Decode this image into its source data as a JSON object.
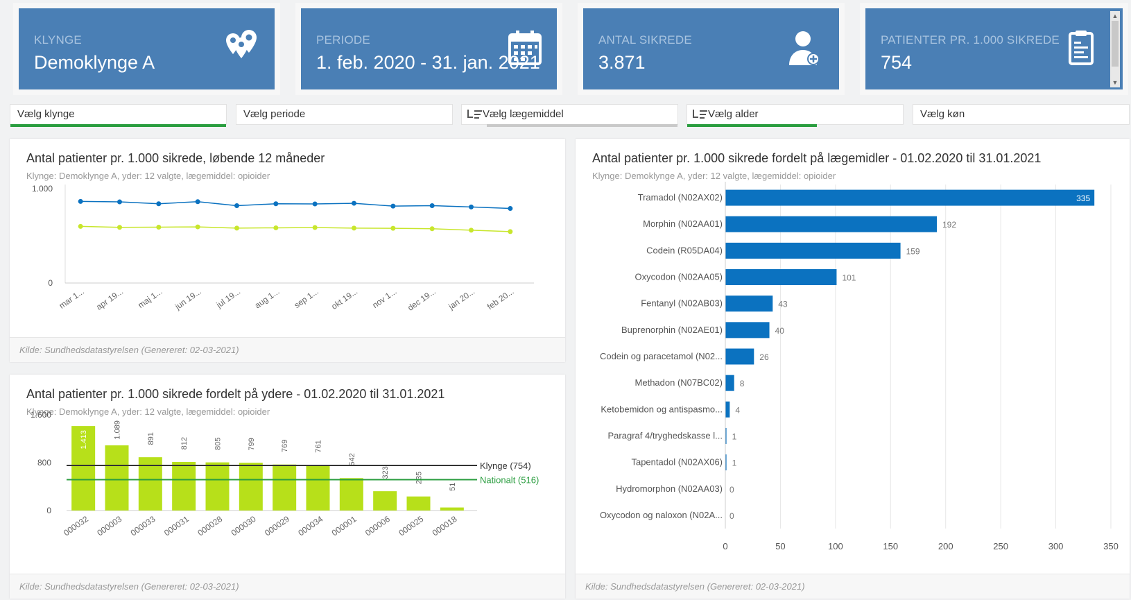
{
  "kpis": [
    {
      "label": "KLYNGE",
      "value": "Demoklynge A",
      "icon": "map-pins-icon"
    },
    {
      "label": "PERIODE",
      "value": "1. feb. 2020 - 31. jan. 2021",
      "icon": "calendar-icon"
    },
    {
      "label": "ANTAL SIKREDE",
      "value": "3.871",
      "icon": "user-plus-icon"
    },
    {
      "label": "PATIENTER PR. 1.000 SIKREDE",
      "value": "754",
      "icon": "clipboard-icon"
    }
  ],
  "filters": [
    {
      "label": "Vælg klynge",
      "has_icon": false,
      "bar_color": "#2a9d3f",
      "bar_fraction": 1.0
    },
    {
      "label": "Vælg periode",
      "has_icon": false,
      "bar_color": "",
      "bar_fraction": 0
    },
    {
      "label": "Vælg lægemiddel",
      "has_icon": true,
      "bar_color": "#c9c9c9",
      "bar_fraction": 1.0
    },
    {
      "label": "Vælg alder",
      "has_icon": true,
      "bar_color": "#2a9d3f",
      "bar_fraction": 0.6
    },
    {
      "label": "Vælg køn",
      "has_icon": false,
      "bar_color": "",
      "bar_fraction": 0
    }
  ],
  "colors": {
    "kpi_bg": "#4a7fb5",
    "blue": "#0b72c0",
    "lime": "#b7e01a",
    "green": "#2a9d3f",
    "line_lime": "#c8e62c"
  },
  "footer_text": "Kilde: Sundhedsdatastyrelsen (Genereret: 02-03-2021)",
  "chart_data": [
    {
      "type": "line",
      "title": "Antal patienter pr. 1.000 sikrede, løbende 12 måneder",
      "subtitle": "Klynge: Demoklynge A, yder: 12 valgte, lægemiddel: opioider",
      "categories": [
        "mar 1...",
        "apr 19...",
        "maj 1...",
        "jun 19...",
        "jul 19...",
        "aug 1...",
        "sep 1...",
        "okt 19...",
        "nov 1...",
        "dec 19...",
        "jan 20...",
        "feb 20..."
      ],
      "series": [
        {
          "color": "#0b72c0",
          "values": [
            865,
            860,
            840,
            862,
            820,
            840,
            838,
            845,
            815,
            820,
            806,
            790
          ]
        },
        {
          "color": "#c8e62c",
          "values": [
            600,
            590,
            592,
            595,
            582,
            585,
            588,
            582,
            580,
            575,
            560,
            545
          ]
        }
      ],
      "yticks": [
        "0",
        "1.000"
      ],
      "ylim": [
        0,
        1000
      ]
    },
    {
      "type": "bar",
      "title": "Antal patienter pr. 1.000 sikrede fordelt på ydere - 01.02.2020 til 31.01.2021",
      "subtitle": "Klynge: Demoklynge A, yder: 12 valgte, lægemiddel: opioider",
      "categories": [
        "000032",
        "000003",
        "000033",
        "000031",
        "000028",
        "000030",
        "000029",
        "000034",
        "000001",
        "000006",
        "000025",
        "000018"
      ],
      "values": [
        1413,
        1089,
        891,
        812,
        805,
        799,
        769,
        761,
        542,
        323,
        235,
        51
      ],
      "value_labels": [
        "1.413",
        "1.089",
        "891",
        "812",
        "805",
        "799",
        "769",
        "761",
        "542",
        "323",
        "235",
        "51"
      ],
      "yticks": [
        "0",
        "800",
        "1.600"
      ],
      "ylim": [
        0,
        1600
      ],
      "reference_lines": [
        {
          "label": "Klynge (754)",
          "value": 754,
          "color": "#333333"
        },
        {
          "label": "Nationalt (516)",
          "value": 516,
          "color": "#2a9d3f"
        }
      ]
    },
    {
      "type": "bar",
      "orientation": "horizontal",
      "title": "Antal patienter pr. 1.000 sikrede fordelt på lægemidler - 01.02.2020 til 31.01.2021",
      "subtitle": "Klynge: Demoklynge A, yder: 12 valgte, lægemiddel: opioider",
      "categories": [
        "Tramadol (N02AX02)",
        "Morphin (N02AA01)",
        "Codein (R05DA04)",
        "Oxycodon (N02AA05)",
        "Fentanyl (N02AB03)",
        "Buprenorphin (N02AE01)",
        "Codein og paracetamol (N02...",
        "Methadon (N07BC02)",
        "Ketobemidon og antispasmo...",
        "Paragraf 4/tryghedskasse l...",
        "Tapentadol (N02AX06)",
        "Hydromorphon (N02AA03)",
        "Oxycodon og naloxon (N02A..."
      ],
      "values": [
        335,
        192,
        159,
        101,
        43,
        40,
        26,
        8,
        4,
        1,
        1,
        0,
        0
      ],
      "xticks": [
        "0",
        "50",
        "100",
        "150",
        "200",
        "250",
        "300",
        "350"
      ],
      "xlim": [
        0,
        350
      ]
    }
  ]
}
